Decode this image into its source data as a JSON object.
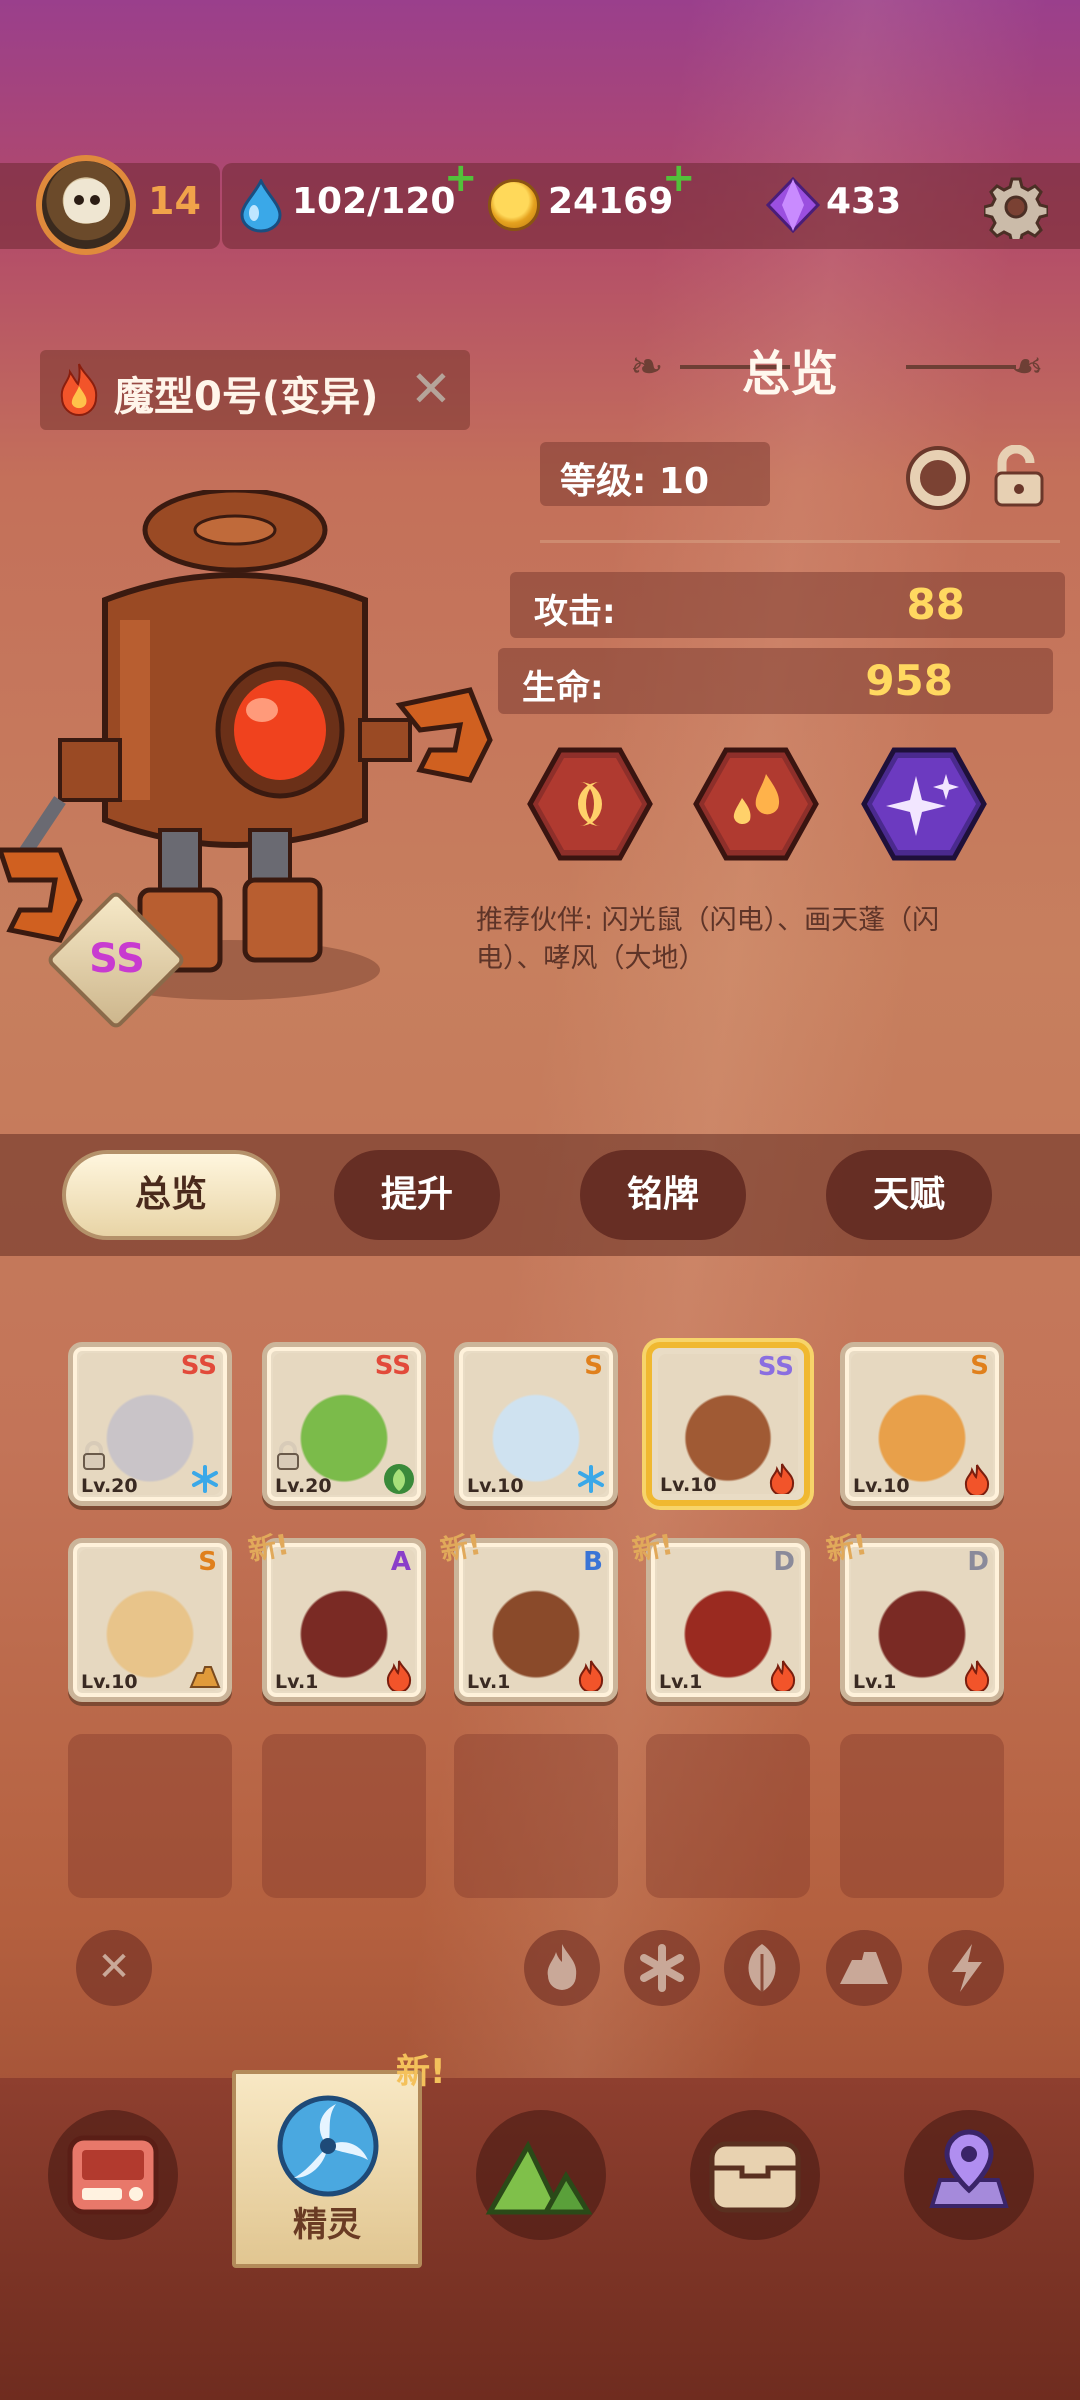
{
  "header": {
    "player_level": "14",
    "stamina": "102/120",
    "coins": "24169",
    "gems": "433",
    "settings_icon": "gear-icon"
  },
  "creature": {
    "name": "魔型0号(变异)",
    "rank": "SS",
    "element_icon": "fire-icon"
  },
  "overview": {
    "title": "总览",
    "level_label": "等级: 10",
    "attack_label": "攻击:",
    "attack_value": "88",
    "hp_label": "生命:",
    "hp_value": "958",
    "skills": [
      "moon-crescent-skill-icon",
      "fire-drops-skill-icon",
      "sparkle-skill-icon"
    ],
    "recommend_text": "推荐伙伴: 闪光鼠（闪电）、画天蓬（闪电）、哮风（大地）"
  },
  "tabs": [
    "总览",
    "提升",
    "铭牌",
    "天赋"
  ],
  "creatures_grid": [
    {
      "rank": "SS",
      "level": "Lv.20",
      "element": "ice",
      "locked": true,
      "new": false,
      "rank_color": "#e24a3a"
    },
    {
      "rank": "SS",
      "level": "Lv.20",
      "element": "leaf",
      "locked": true,
      "new": false,
      "rank_color": "#e24a3a"
    },
    {
      "rank": "S",
      "level": "Lv.10",
      "element": "ice",
      "locked": false,
      "new": false,
      "rank_color": "#e0801c"
    },
    {
      "rank": "SS",
      "level": "Lv.10",
      "element": "fire",
      "locked": false,
      "new": false,
      "rank_color": "#8a6ee0",
      "selected": true
    },
    {
      "rank": "S",
      "level": "Lv.10",
      "element": "fire",
      "locked": false,
      "new": false,
      "rank_color": "#e0801c"
    },
    {
      "rank": "S",
      "level": "Lv.10",
      "element": "earth",
      "locked": false,
      "new": false,
      "rank_color": "#e0801c"
    },
    {
      "rank": "A",
      "level": "Lv.1",
      "element": "fire",
      "locked": false,
      "new": true,
      "rank_color": "#8a3ec9"
    },
    {
      "rank": "B",
      "level": "Lv.1",
      "element": "fire",
      "locked": false,
      "new": true,
      "rank_color": "#3a74d6"
    },
    {
      "rank": "D",
      "level": "Lv.1",
      "element": "fire",
      "locked": false,
      "new": true,
      "rank_color": "#8a8a9a"
    },
    {
      "rank": "D",
      "level": "Lv.1",
      "element": "fire",
      "locked": false,
      "new": true,
      "rank_color": "#8a8a9a"
    }
  ],
  "new_tag": "新!",
  "filters": [
    "clear-filter-icon",
    "fire-filter-icon",
    "ice-filter-icon",
    "leaf-filter-icon",
    "earth-filter-icon",
    "lightning-filter-icon"
  ],
  "bottom_nav": {
    "items": [
      "console-icon",
      "spirit-icon",
      "mountain-icon",
      "chest-icon",
      "map-pin-icon"
    ],
    "active_label": "精灵",
    "new_badge": "新!"
  }
}
